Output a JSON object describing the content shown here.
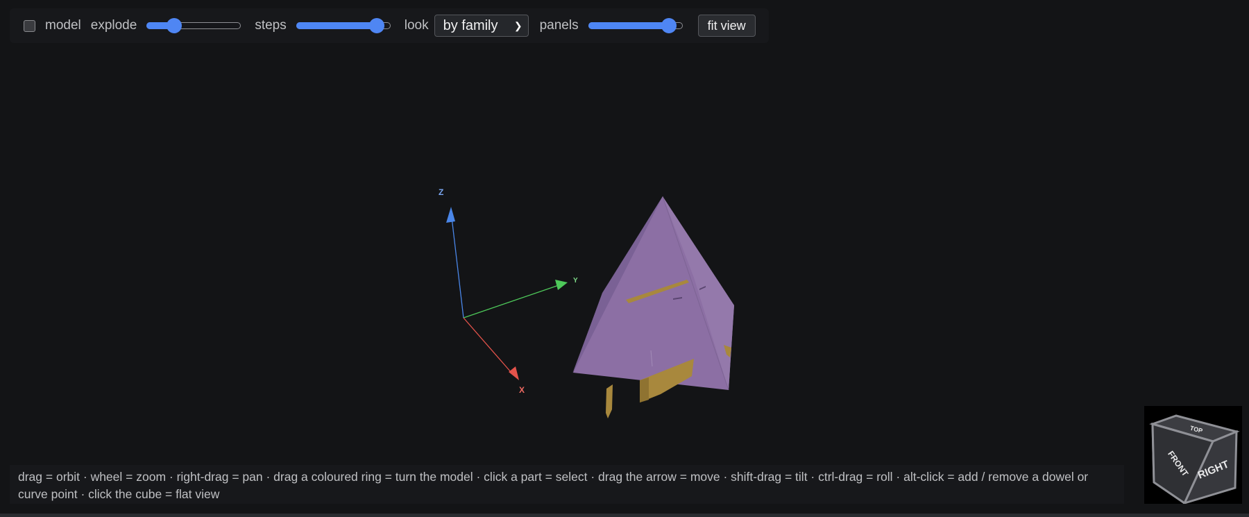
{
  "toolbar": {
    "model_label": "model",
    "model_checked": false,
    "explode_label": "explode",
    "explode_value": 0.25,
    "steps_label": "steps",
    "steps_value": 0.92,
    "look_label": "look",
    "look_selected": "by family",
    "panels_label": "panels",
    "panels_value": 0.92,
    "fit_view_label": "fit view"
  },
  "axes": {
    "x_label": "X",
    "y_label": "Y",
    "z_label": "Z",
    "x_color": "#e5534b",
    "y_color": "#4ec95a",
    "z_color": "#4a86e8"
  },
  "colors": {
    "panel_main": "#8b6ea3",
    "dowel": "#a8883d",
    "background": "#131416",
    "accent": "#4f86f3"
  },
  "hint": {
    "text": "drag = orbit · wheel = zoom · right-drag = pan · drag a coloured ring = turn the model · click a part = select · drag the arrow = move · shift-drag = tilt · ctrl-drag = roll · alt-click = add / remove a dowel or curve point · click the cube = flat view"
  },
  "viewcube": {
    "top": "TOP",
    "front": "FRONT",
    "right": "RIGHT"
  }
}
